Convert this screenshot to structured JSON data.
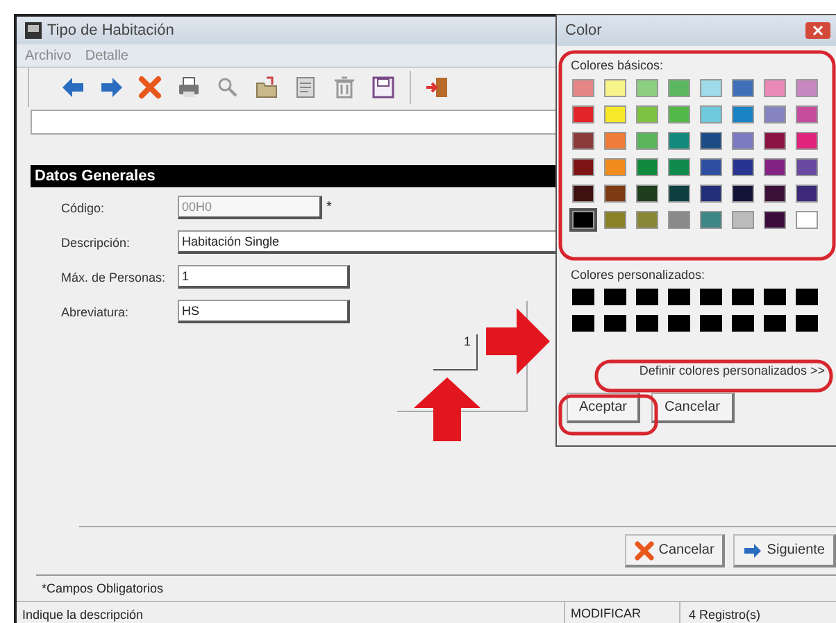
{
  "window": {
    "title": "Tipo de Habitación"
  },
  "menu": [
    {
      "label": "Archivo"
    },
    {
      "label": "Detalle"
    }
  ],
  "toolbar": [
    {
      "kind": "back"
    },
    {
      "kind": "forward"
    },
    {
      "kind": "delete"
    },
    {
      "kind": "print"
    },
    {
      "kind": "search"
    },
    {
      "kind": "folder"
    },
    {
      "kind": "document"
    },
    {
      "kind": "trash"
    },
    {
      "kind": "save"
    },
    {
      "kind": "exit"
    }
  ],
  "section": {
    "title": "Datos Generales"
  },
  "fields": [
    {
      "label": "Código:",
      "value": "00H0",
      "disabled": true,
      "required_mark": "*"
    },
    {
      "label": "Descripción:",
      "value": "Habitación Single",
      "disabled": false
    },
    {
      "label": "Máx. de Personas:",
      "value": "1",
      "disabled": false
    },
    {
      "label": "Abreviatura:",
      "value": "HS",
      "disabled": false
    }
  ],
  "preview": {
    "value": "1"
  },
  "buttons": [
    {
      "label": "Cancelar",
      "kind": "cancel"
    },
    {
      "label": "Siguiente",
      "kind": "next"
    }
  ],
  "footnote": "*Campos Obligatorios",
  "status_bar": [
    "Indique la descripción",
    "MODIFICAR",
    "4 Registro(s)"
  ],
  "color_dialog": {
    "title": "Color",
    "basic_label": "Colores básicos:",
    "basic_colors": [
      {
        "color": "#e58585",
        "selected": false
      },
      {
        "color": "#f6f48a",
        "selected": false
      },
      {
        "color": "#8ccf80",
        "selected": false
      },
      {
        "color": "#5cb860",
        "selected": false
      },
      {
        "color": "#9fdbe8",
        "selected": false
      },
      {
        "color": "#3f6fb8",
        "selected": false
      },
      {
        "color": "#e98ab8",
        "selected": false
      },
      {
        "color": "#c688be",
        "selected": false
      },
      {
        "color": "#e3252b",
        "selected": false
      },
      {
        "color": "#f7e92a",
        "selected": false
      },
      {
        "color": "#7ec242",
        "selected": false
      },
      {
        "color": "#52b948",
        "selected": false
      },
      {
        "color": "#6ec9dd",
        "selected": false
      },
      {
        "color": "#1b82c4",
        "selected": false
      },
      {
        "color": "#8584c0",
        "selected": false
      },
      {
        "color": "#c64c9e",
        "selected": false
      },
      {
        "color": "#8c3b3b",
        "selected": false
      },
      {
        "color": "#ef7c38",
        "selected": false
      },
      {
        "color": "#5cb45c",
        "selected": false
      },
      {
        "color": "#14897e",
        "selected": false
      },
      {
        "color": "#1d4c84",
        "selected": false
      },
      {
        "color": "#7b7bc2",
        "selected": false
      },
      {
        "color": "#8c1444",
        "selected": false
      },
      {
        "color": "#e0247c",
        "selected": false
      },
      {
        "color": "#7d1313",
        "selected": false
      },
      {
        "color": "#f28c1c",
        "selected": false
      },
      {
        "color": "#108a3c",
        "selected": false
      },
      {
        "color": "#0f8a4a",
        "selected": false
      },
      {
        "color": "#2d4ea0",
        "selected": false
      },
      {
        "color": "#283490",
        "selected": false
      },
      {
        "color": "#842284",
        "selected": false
      },
      {
        "color": "#6a4aa0",
        "selected": false
      },
      {
        "color": "#3e1010",
        "selected": false
      },
      {
        "color": "#7e3a10",
        "selected": false
      },
      {
        "color": "#1e3e1e",
        "selected": false
      },
      {
        "color": "#0e4040",
        "selected": false
      },
      {
        "color": "#232e78",
        "selected": false
      },
      {
        "color": "#141438",
        "selected": false
      },
      {
        "color": "#3a1038",
        "selected": false
      },
      {
        "color": "#3c2a78",
        "selected": false
      },
      {
        "color": "#000000",
        "selected": true
      },
      {
        "color": "#8a8026",
        "selected": false
      },
      {
        "color": "#888838",
        "selected": false
      },
      {
        "color": "#8a8a8a",
        "selected": false
      },
      {
        "color": "#3f8686",
        "selected": false
      },
      {
        "color": "#bcbcbc",
        "selected": false
      },
      {
        "color": "#3c0c3c",
        "selected": false
      },
      {
        "color": "#ffffff",
        "selected": false
      }
    ],
    "custom_label": "Colores personalizados:",
    "custom_colors": [
      {
        "color": "#000000"
      },
      {
        "color": "#000000"
      },
      {
        "color": "#000000"
      },
      {
        "color": "#000000"
      },
      {
        "color": "#000000"
      },
      {
        "color": "#000000"
      },
      {
        "color": "#000000"
      },
      {
        "color": "#000000"
      },
      {
        "color": "#000000"
      },
      {
        "color": "#000000"
      },
      {
        "color": "#000000"
      },
      {
        "color": "#000000"
      },
      {
        "color": "#000000"
      },
      {
        "color": "#000000"
      },
      {
        "color": "#000000"
      },
      {
        "color": "#000000"
      }
    ],
    "define_button": "Definir colores personalizados >>",
    "buttons": [
      {
        "label": "Aceptar"
      },
      {
        "label": "Cancelar"
      }
    ]
  }
}
